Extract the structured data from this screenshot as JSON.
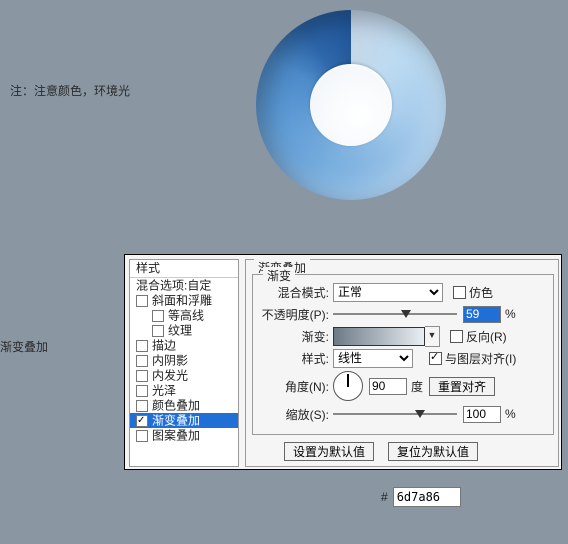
{
  "note_text": "注：注意颜色，环境光",
  "main_effect_label": "渐变叠加",
  "styles_panel": {
    "header": "样式",
    "blend_options": "混合选项:自定",
    "items": [
      {
        "label": "斜面和浮雕",
        "checked": false,
        "indent": false
      },
      {
        "label": "等高线",
        "checked": false,
        "indent": true
      },
      {
        "label": "纹理",
        "checked": false,
        "indent": true
      },
      {
        "label": "描边",
        "checked": false,
        "indent": false
      },
      {
        "label": "内阴影",
        "checked": false,
        "indent": false
      },
      {
        "label": "内发光",
        "checked": false,
        "indent": false
      },
      {
        "label": "光泽",
        "checked": false,
        "indent": false
      },
      {
        "label": "颜色叠加",
        "checked": false,
        "indent": false
      },
      {
        "label": "渐变叠加",
        "checked": true,
        "indent": false,
        "selected": true
      },
      {
        "label": "图案叠加",
        "checked": false,
        "indent": false
      }
    ]
  },
  "panel": {
    "group_title": "渐变叠加",
    "subgroup_title": "渐变",
    "blend_mode_label": "混合模式:",
    "blend_mode_value": "正常",
    "dither_label": "仿色",
    "dither_checked": false,
    "opacity_label": "不透明度(P):",
    "opacity_value": "59",
    "opacity_unit": "%",
    "opacity_percent": 59,
    "gradient_label": "渐变:",
    "reverse_label": "反向(R)",
    "reverse_checked": false,
    "style_label": "样式:",
    "style_value": "线性",
    "align_label": "与图层对齐(I)",
    "align_checked": true,
    "angle_label": "角度(N):",
    "angle_value": "90",
    "angle_unit": "度",
    "reset_align_button": "重置对齐",
    "scale_label": "缩放(S):",
    "scale_value": "100",
    "scale_unit": "%",
    "scale_percent": 70,
    "make_default_button": "设置为默认值",
    "reset_default_button": "复位为默认值"
  },
  "hex": {
    "hash": "#",
    "value": "6d7a86"
  }
}
